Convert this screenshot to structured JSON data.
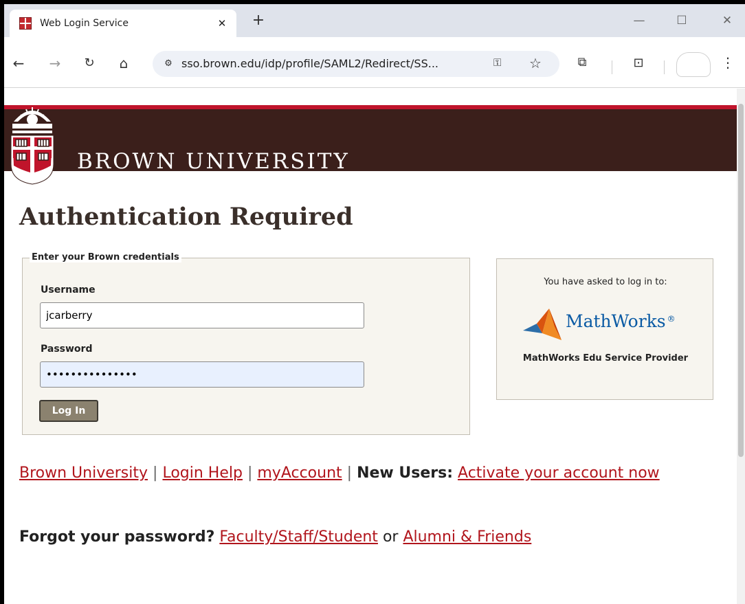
{
  "browser": {
    "tab": {
      "title": "Web Login Service",
      "close_glyph": "✕"
    },
    "new_tab_glyph": "+",
    "window_controls": {
      "minimize": "—",
      "maximize": "☐",
      "close": "✕"
    },
    "nav": {
      "back": "←",
      "forward": "→",
      "reload": "↻",
      "home": "⌂"
    },
    "url": "sso.brown.edu/idp/profile/SAML2/Redirect/SS...",
    "icons": {
      "site_info": "site-info-icon",
      "key": "key-icon",
      "star": "star-icon",
      "extensions": "extensions-icon",
      "tab_search": "tab-search-icon",
      "menu": "menu-icon"
    },
    "glyphs": {
      "site_info": "⚙",
      "key": "⚿",
      "star": "☆",
      "extensions": "⧉",
      "tab_search": "⊡",
      "menu": "⋮"
    }
  },
  "banner": {
    "name": "BROWN UNIVERSITY",
    "color": "#3b1f1b",
    "accent": "#c0142b"
  },
  "page": {
    "title": "Authentication Required",
    "credentials": {
      "legend": "Enter your Brown credentials",
      "username_label": "Username",
      "username_value": "jcarberry",
      "password_label": "Password",
      "password_value": "•••••••••••••••",
      "login_button": "Log In"
    },
    "service_provider": {
      "intro": "You have asked to log in to:",
      "logo_text": "MathWorks",
      "logo_reg": "®",
      "name": "MathWorks Edu Service Provider"
    },
    "links": {
      "brown_university": "Brown University",
      "sep": "|",
      "login_help": "Login Help",
      "my_account": "myAccount",
      "new_users_label": "New Users:",
      "activate": "Activate your account now"
    },
    "forgot": {
      "label": "Forgot your password?",
      "faculty": "Faculty/Staff/Student",
      "or": "or",
      "alumni": "Alumni & Friends"
    }
  },
  "colors": {
    "link": "#b1151c",
    "button": "#8b826f",
    "box_bg": "#f7f5ef",
    "mathworks_blue": "#0a5aa4"
  }
}
